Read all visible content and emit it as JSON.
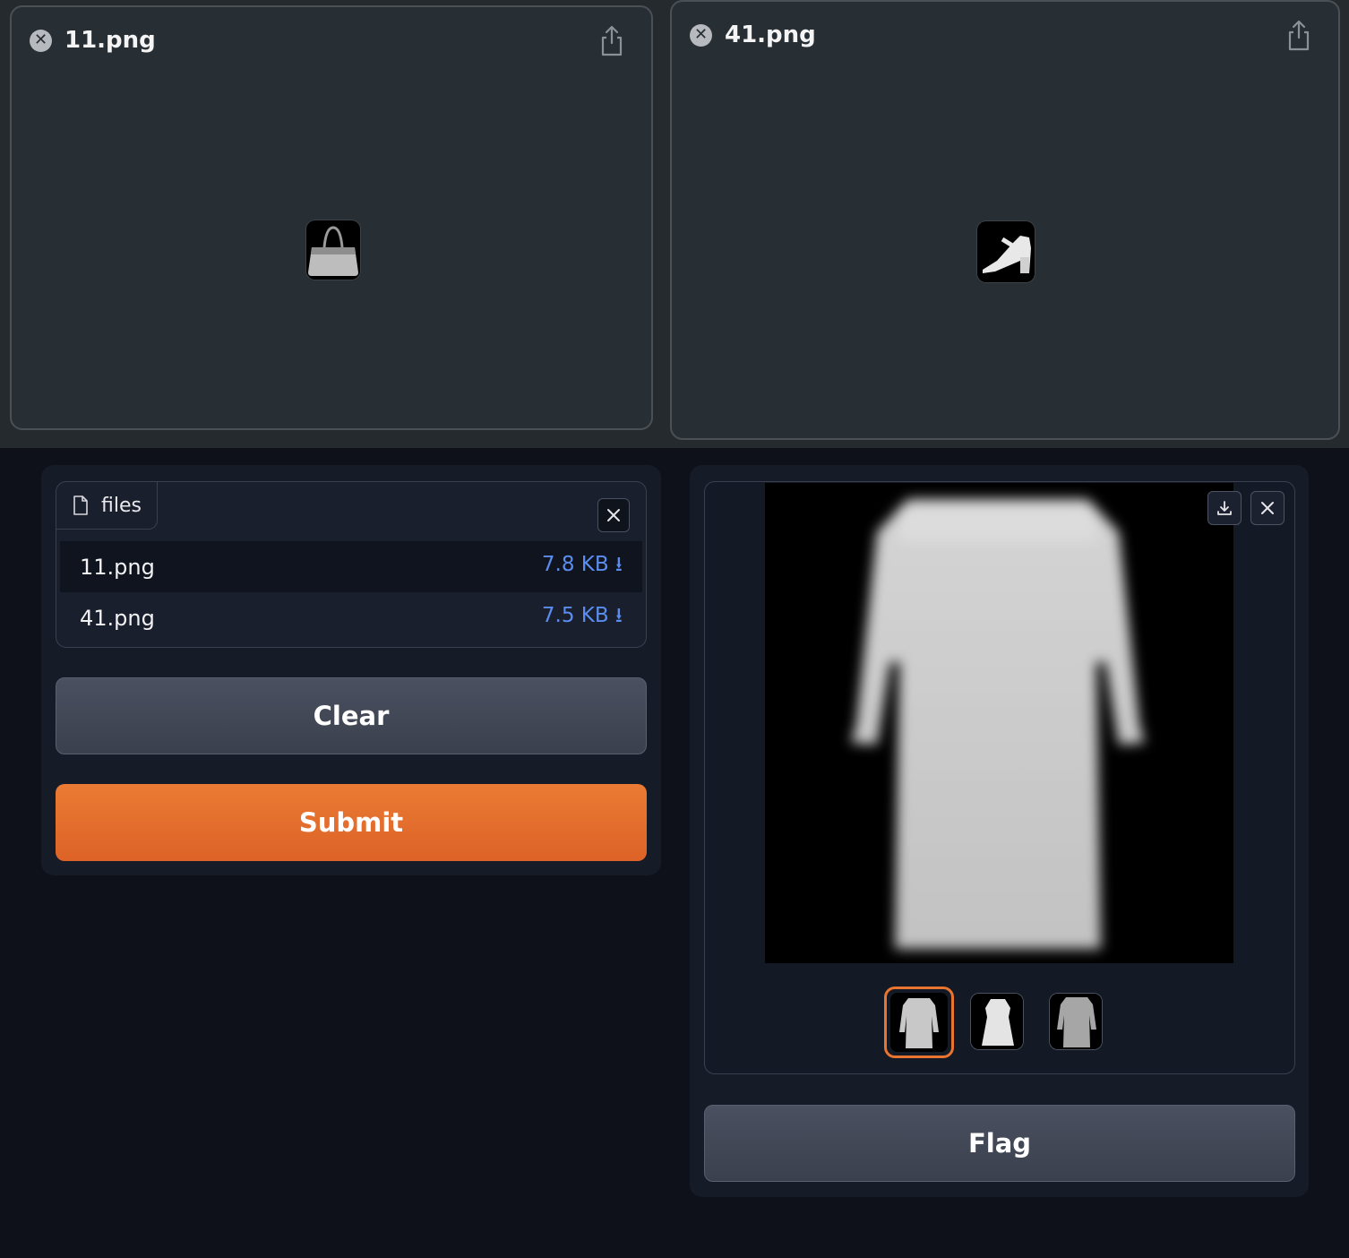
{
  "previews": [
    {
      "title": "11.png",
      "image": "handbag"
    },
    {
      "title": "41.png",
      "image": "sandal"
    }
  ],
  "file_upload": {
    "tab_label": "files",
    "files": [
      {
        "name": "11.png",
        "size": "7.8 KB ⭳"
      },
      {
        "name": "41.png",
        "size": "7.5 KB ⭳"
      }
    ]
  },
  "buttons": {
    "clear": "Clear",
    "submit": "Submit",
    "flag": "Flag"
  },
  "gallery": {
    "main_image": "dress",
    "thumbnails": [
      "dress",
      "dress",
      "dress"
    ],
    "selected_index": 0
  },
  "colors": {
    "accent": "#e8742f",
    "link": "#5b8def",
    "background": "#0e111a"
  }
}
